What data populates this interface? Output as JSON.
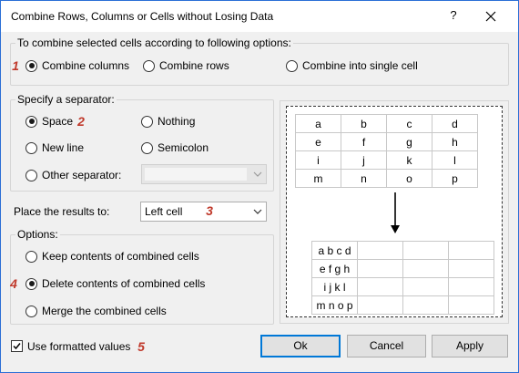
{
  "window": {
    "title": "Combine Rows, Columns or Cells without Losing Data",
    "help": "?"
  },
  "combine": {
    "label": "To combine selected cells according to following options:",
    "options": [
      "Combine columns",
      "Combine rows",
      "Combine into single cell"
    ],
    "selected": "Combine columns",
    "badge": "1"
  },
  "separator": {
    "label": "Specify a separator:",
    "options": [
      "Space",
      "Nothing",
      "New line",
      "Semicolon",
      "Other separator:"
    ],
    "selected": "Space",
    "badge": "2",
    "other_value": ""
  },
  "results": {
    "label": "Place the results to:",
    "value": "Left cell",
    "badge": "3"
  },
  "options": {
    "label": "Options:",
    "items": [
      "Keep contents of combined cells",
      "Delete contents of combined cells",
      "Merge the combined cells"
    ],
    "selected": "Delete contents of combined cells",
    "badge": "4"
  },
  "formatted": {
    "label": "Use formatted values",
    "checked": true,
    "badge": "5"
  },
  "buttons": {
    "ok": "Ok",
    "cancel": "Cancel",
    "apply": "Apply"
  },
  "preview": {
    "before": [
      [
        "a",
        "b",
        "c",
        "d"
      ],
      [
        "e",
        "f",
        "g",
        "h"
      ],
      [
        "i",
        "j",
        "k",
        "l"
      ],
      [
        "m",
        "n",
        "o",
        "p"
      ]
    ],
    "after": [
      [
        "a b c d",
        "",
        "",
        ""
      ],
      [
        "e f g h",
        "",
        "",
        ""
      ],
      [
        "i j k l",
        "",
        "",
        ""
      ],
      [
        "m n o p",
        "",
        "",
        ""
      ]
    ]
  },
  "colors": {
    "accent": "#0078d7",
    "badge": "#c0392b",
    "title_border": "#2b6fd6"
  }
}
